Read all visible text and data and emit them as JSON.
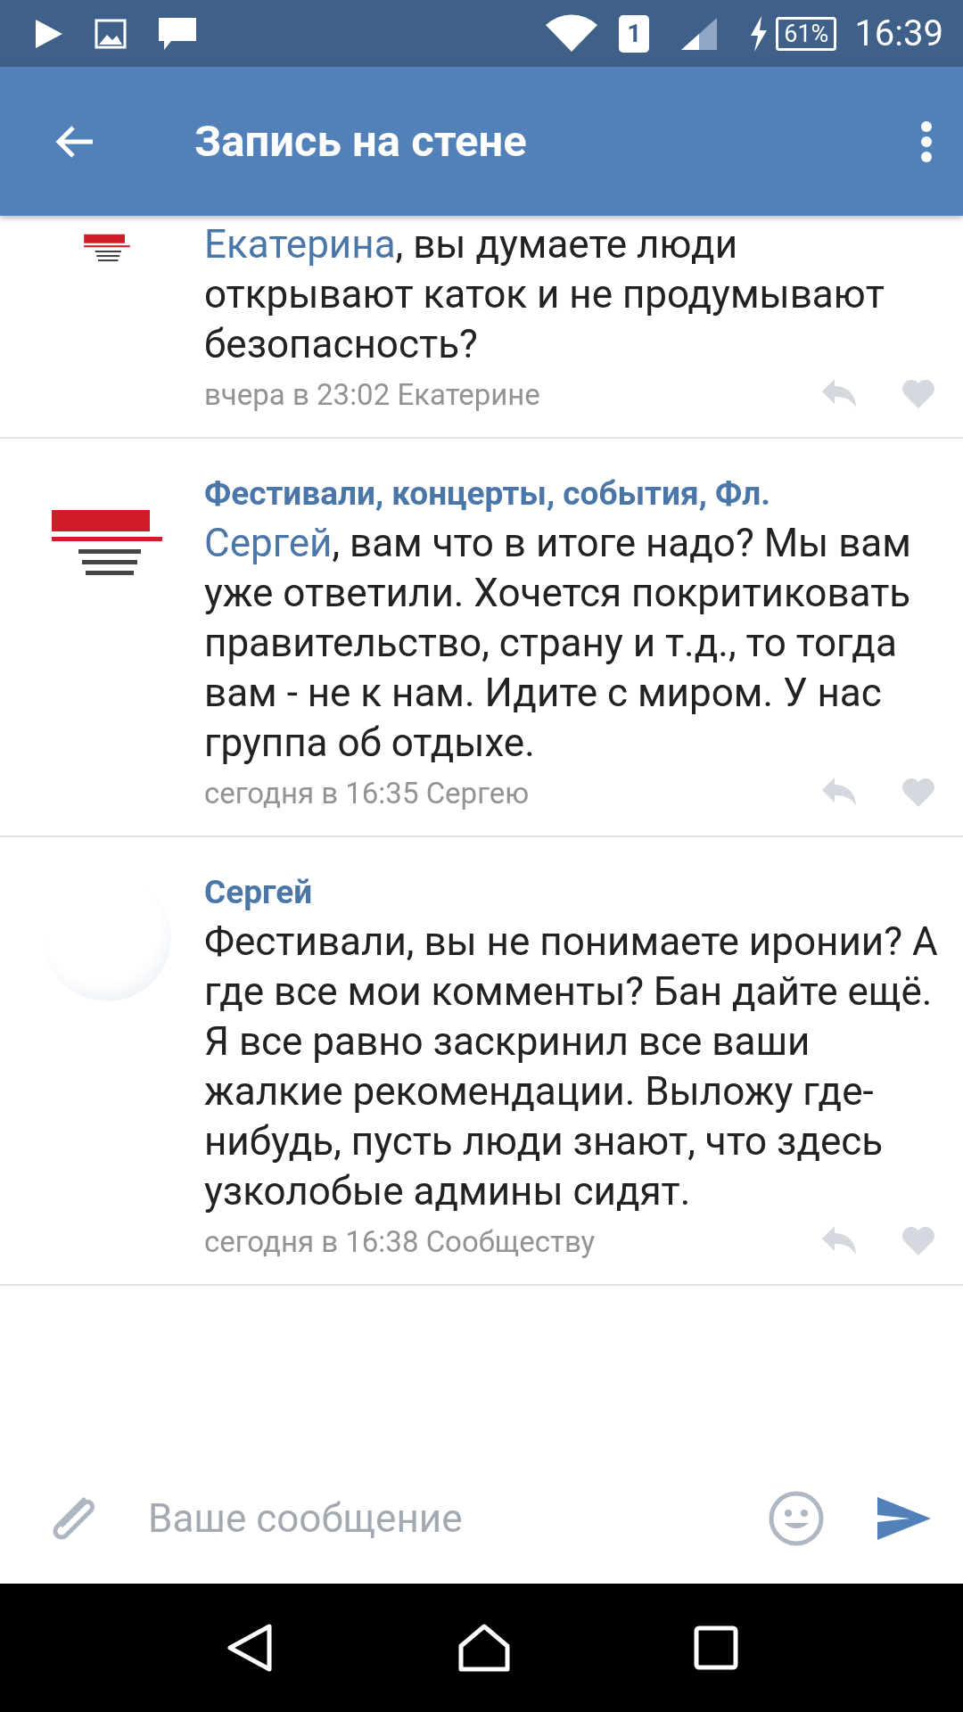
{
  "status_bar": {
    "sim": "1",
    "battery": "61%",
    "time": "16:39"
  },
  "app_bar": {
    "title": "Запись на стене"
  },
  "comments": [
    {
      "kind": "logo",
      "mention": "Екатерина",
      "text": ", вы думаете люди открывают каток и не продумывают безопасность?",
      "meta": "вчера в 23:02 Екатерине",
      "liked": false
    },
    {
      "author": "Фестивали, концерты, события, Фл.",
      "kind": "logo",
      "mention": "Сергей",
      "text": ", вам что в итоге надо? Мы вам уже ответили. Хочется покритиковать правительство, страну и т.д., то тогда вам - не к нам. Идите с миром. У нас группа об отдыхе.",
      "meta": "сегодня в 16:35 Сергею",
      "liked": false
    },
    {
      "author": "Сергей",
      "kind": "photo",
      "text": "Фестивали, вы не понимаете иронии? А где все мои комменты? Бан дайте ещё. Я все равно заскринил все ваши жалкие рекомендации. Выложу где-нибудь, пусть люди знают, что здесь узколобые админы сидят.",
      "meta": "сегодня в 16:38 Сообществу",
      "liked": false
    }
  ],
  "composer": {
    "placeholder": "Ваше сообщение"
  }
}
